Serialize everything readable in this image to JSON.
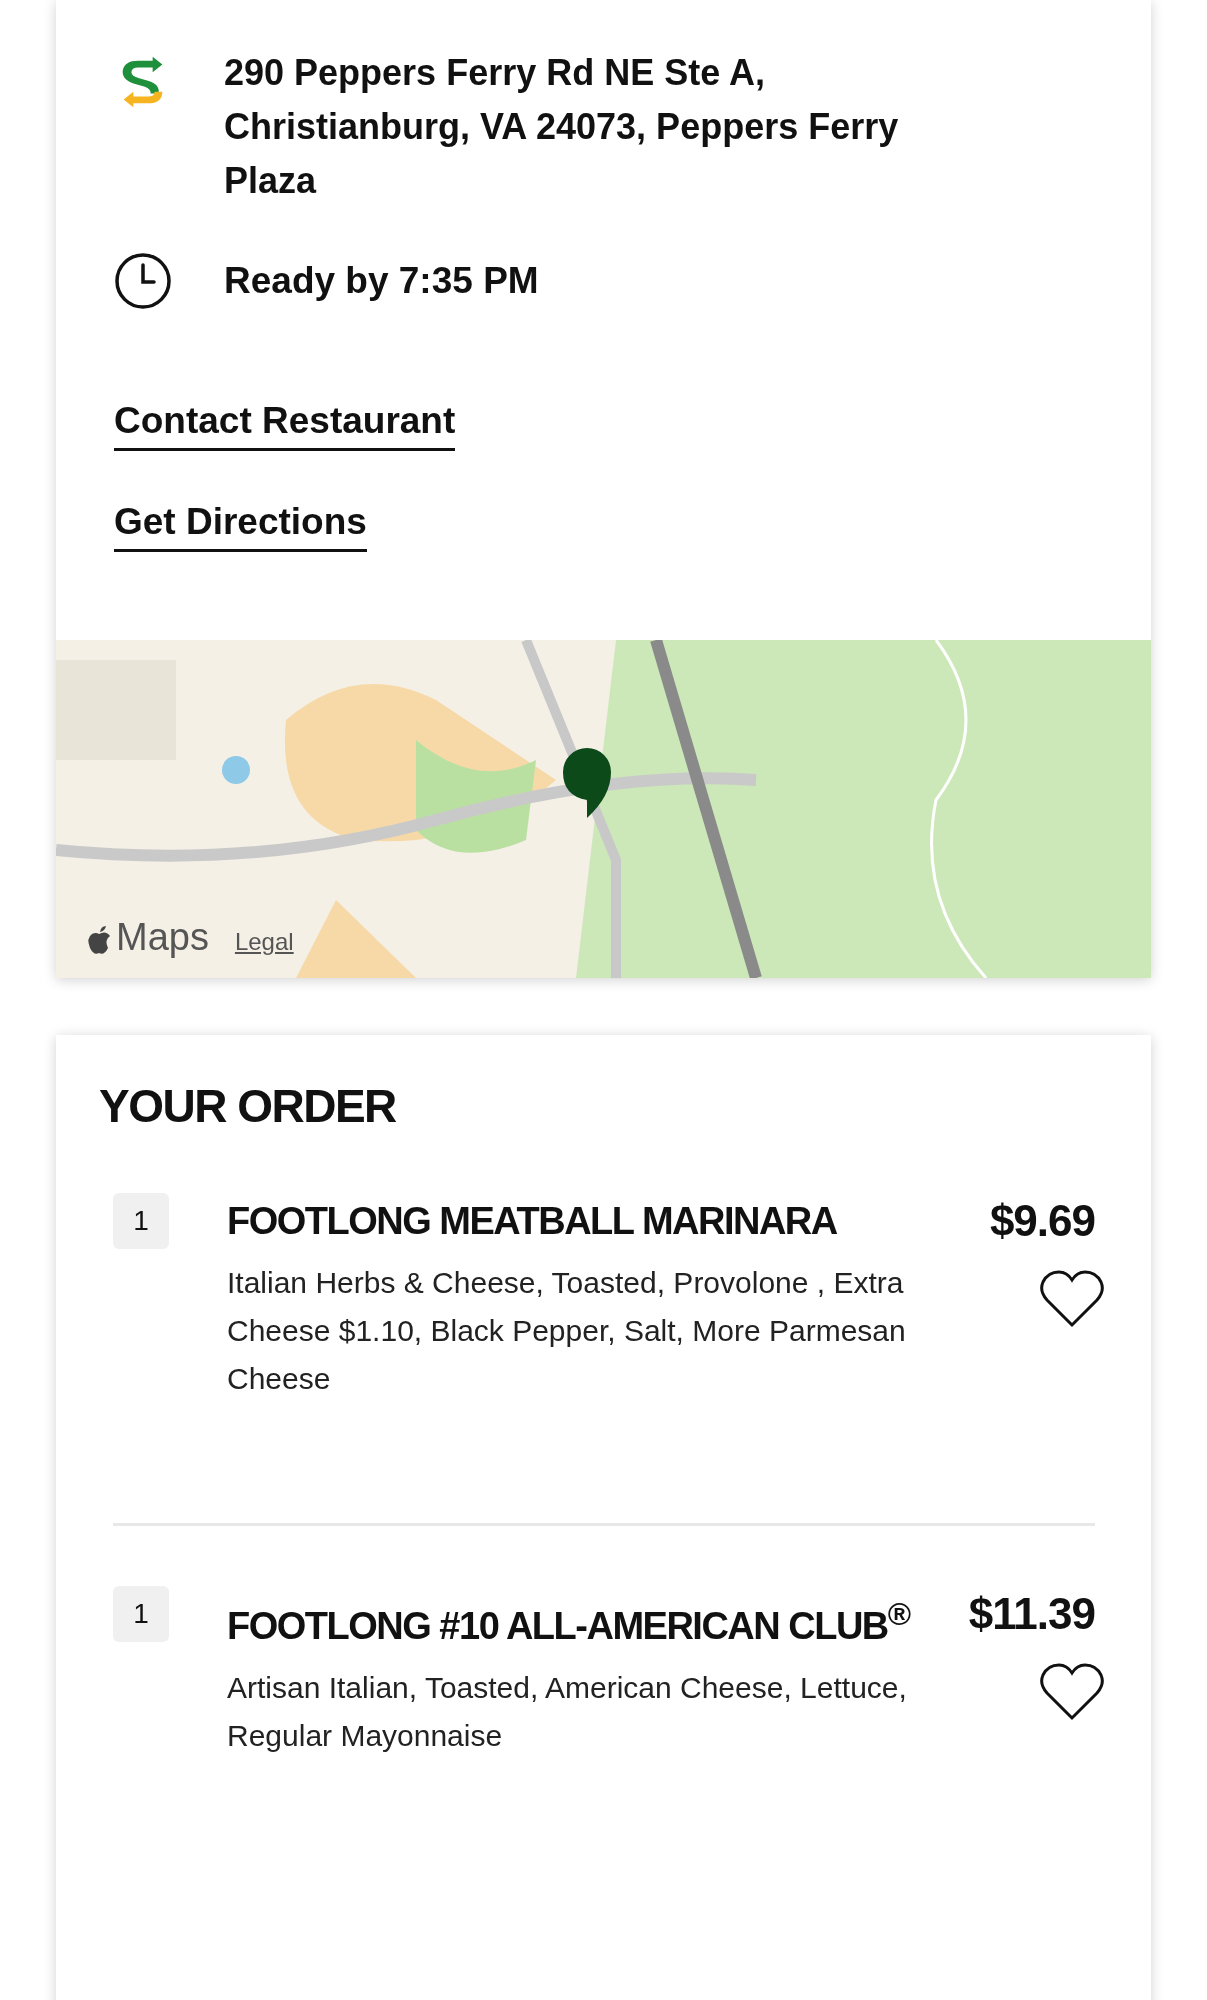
{
  "store": {
    "address": "290 Peppers Ferry Rd NE Ste A, Christianburg, VA 24073, Peppers Ferry Plaza",
    "ready": "Ready by 7:35 PM"
  },
  "links": [
    "Contact Restaurant",
    "Get Directions"
  ],
  "map": {
    "attribution": "Maps",
    "legal": "Legal"
  },
  "order": {
    "title": "YOUR ORDER",
    "items": [
      {
        "qty": "1",
        "name": "FOOTLONG MEATBALL MARINARA",
        "price": "$9.69",
        "description": "Italian Herbs & Cheese, Toasted, Provolone , Extra Cheese $1.10, Black Pepper, Salt, More Parmesan Cheese",
        "favorite": false
      },
      {
        "qty": "1",
        "name": "FOOTLONG #10 ALL-AMERICAN CLUB$^{®}$",
        "price": "$11.39",
        "description": "Artisan Italian, Toasted, American Cheese, Lettuce, Regular Mayonnaise",
        "favorite": false
      }
    ]
  }
}
